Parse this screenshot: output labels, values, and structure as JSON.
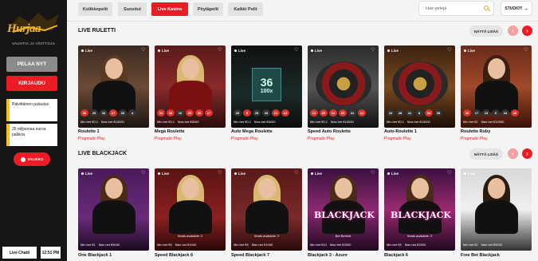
{
  "brand": {
    "logo_text": "Hurjaa",
    "tagline": "VAUHTIA JA VOITTOJA"
  },
  "sidebar": {
    "play_button": "PELAA NYT",
    "login_button": "KIRJAUDU",
    "promo1": "Päivittäinen palautus",
    "promo2": "25 miljoonaa euroa palkioa",
    "language": "VALIKKO",
    "live_chat": "Live Chatti",
    "clock": "12:51 PM"
  },
  "tabs": [
    "Kolikkopelit",
    "Suositut",
    "Live Kasino",
    "Pöytäpelit",
    "Kaikki Pelit"
  ],
  "search": {
    "placeholder": "Hae pelejä"
  },
  "dropdown": {
    "label": "STUDIOT"
  },
  "sections": [
    {
      "title": "LIVE RULETTI",
      "showmore": "NÄYTÄ LISÄÄ"
    },
    {
      "title": "LIVE BLACKJACK",
      "showmore": "NÄYTÄ LISÄÄ"
    }
  ],
  "roulette_games": [
    {
      "name": "Roulette 1",
      "provider": "Pragmatic Play",
      "results": [
        "32",
        "20",
        "33",
        "27",
        "26",
        "4"
      ],
      "min": "€0.1",
      "max": "€10000"
    },
    {
      "name": "Mega Roulette",
      "provider": "Pragmatic Play",
      "results": [
        "34",
        "16",
        "10",
        "25",
        "36",
        "27"
      ],
      "min": "€0.1",
      "max": "€5000"
    },
    {
      "name": "Auto Mega Roulette",
      "provider": "Pragmatic Play",
      "results": [
        "26",
        "5",
        "29",
        "33",
        "21",
        "14"
      ],
      "min": "€0.1",
      "max": "€5000",
      "screen": "36",
      "multiplier": "100x"
    },
    {
      "name": "Speed Auto Roulette",
      "provider": "Pragmatic Play",
      "results": [
        "12",
        "25",
        "14",
        "23",
        "31",
        "14"
      ],
      "min": "€0.1",
      "max": "€10000"
    },
    {
      "name": "Auto-Roulette 1",
      "provider": "Pragmatic Play",
      "results": [
        "10",
        "28",
        "11",
        "8",
        "34",
        "35"
      ],
      "min": "€0.1",
      "max": "€10000"
    },
    {
      "name": "Roulette Ruby",
      "provider": "Pragmatic Play",
      "results": [
        "32",
        "17",
        "13",
        "6",
        "24",
        "16"
      ],
      "min": "€1",
      "max": "€10000"
    }
  ],
  "blackjack_games": [
    {
      "name": "One Blackjack 1",
      "provider": "Pragmatic Play",
      "players": "",
      "min": "€1",
      "max": "€5000"
    },
    {
      "name": "Speed Blackjack 6",
      "provider": "Pragmatic Play",
      "players": "Seats available: 2",
      "min": "€5",
      "max": "€1000"
    },
    {
      "name": "Speed Blackjack 7",
      "provider": "Pragmatic Play",
      "players": "Seats available: 2",
      "min": "€5",
      "max": "€1000"
    },
    {
      "name": "Blackjack 3 - Azure",
      "provider": "Pragmatic Play",
      "players": "Bet Behind",
      "min": "€10",
      "max": "€2500",
      "banner": "BLACKJACK"
    },
    {
      "name": "Blackjack 6",
      "provider": "Pragmatic Play",
      "players": "Seats available: 3",
      "min": "€5",
      "max": "€2500",
      "banner": "BLACKJACK"
    },
    {
      "name": "Free Bet Blackjack",
      "provider": "Pragmatic Play",
      "players": "",
      "min": "€1",
      "max": "€5000"
    }
  ],
  "live_label": "Live"
}
